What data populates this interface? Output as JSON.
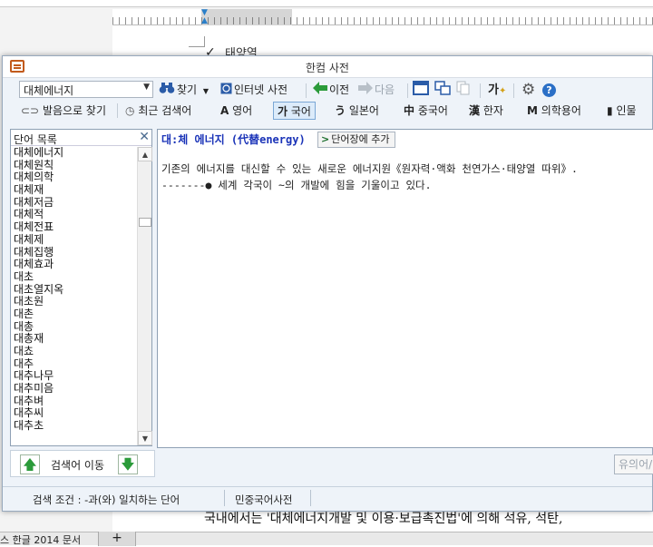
{
  "background": {
    "doc_line_1": "태양열",
    "body_text": "국내에서는 '대체에너지개발 및 이용·보급촉진법'에 의해 석유, 석탄,",
    "taskbar_label": "스 한글 2014 문서",
    "taskbar_plus": "+"
  },
  "window": {
    "title": "한컴 사전"
  },
  "toolbar1": {
    "search_value": "대체에너지",
    "find_label": "찾기",
    "internet_dict_label": "인터넷 사전",
    "prev_label": "이전",
    "next_label": "다음",
    "settings_icon": "gear-icon",
    "help_icon": "help-icon"
  },
  "toolbar2": {
    "pronounce_label": "발음으로 찾기",
    "recent_label": "최근 검색어",
    "english_label": "영어",
    "korean_label": "국어",
    "japanese_label": "일본어",
    "chinese_label": "중국어",
    "hanja_label": "한자",
    "medical_label": "의학용어",
    "people_label": "인물"
  },
  "wordlist": {
    "header": "단어 목록",
    "items": [
      "대체에너지",
      "대체원칙",
      "대체의학",
      "대체재",
      "대체저금",
      "대체적",
      "대체전표",
      "대체제",
      "대체집행",
      "대체효과",
      "대초",
      "대초열지옥",
      "대초원",
      "대촌",
      "대총",
      "대총재",
      "대쵸",
      "대추",
      "대추나무",
      "대추미음",
      "대추벼",
      "대추씨",
      "대추초"
    ]
  },
  "definition": {
    "headword": "대:체 에너지 (代替energy)",
    "add_button": "단어장에 추가",
    "line1": "기존의 에너지를 대신할 수 있는 새로운 에너지원《원자력·액화 천연가스·태양열 따위》.",
    "line2": "-------● 세계 각국이 ~의 개발에 힘을 기울이고 있다."
  },
  "nav": {
    "label": "검색어 이동",
    "lookup_button": "유의어/"
  },
  "status": {
    "condition": "검색 조건 : -과(와) 일치하는 단어",
    "dictionary": "민중국어사전"
  },
  "colors": {
    "headword": "#1a33b8",
    "accent_green": "#2b9b3a"
  }
}
